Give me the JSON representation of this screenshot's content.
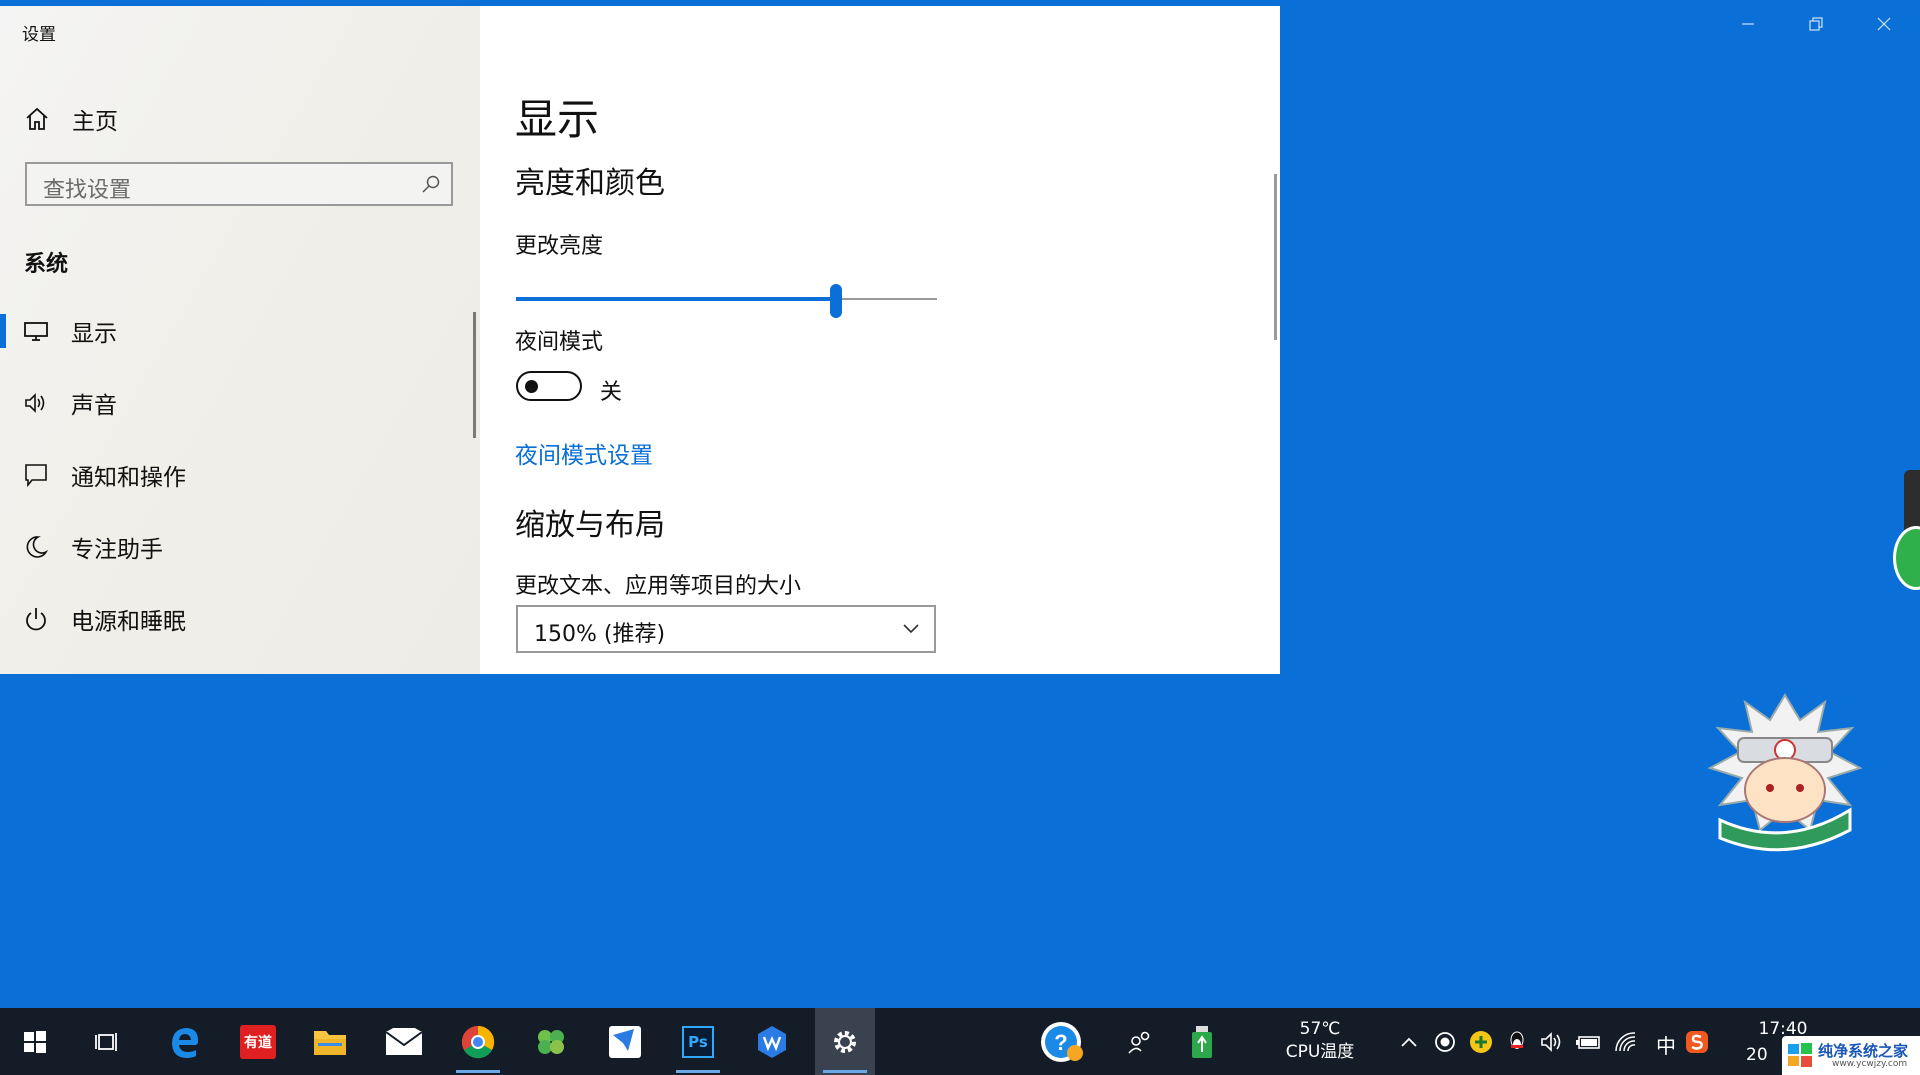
{
  "window": {
    "app_title": "设置"
  },
  "sidebar": {
    "home_label": "主页",
    "search_placeholder": "查找设置",
    "section_title": "系统",
    "items": [
      {
        "label": "显示",
        "icon": "monitor-icon",
        "active": true
      },
      {
        "label": "声音",
        "icon": "speaker-icon"
      },
      {
        "label": "通知和操作",
        "icon": "notification-icon"
      },
      {
        "label": "专注助手",
        "icon": "moon-icon"
      },
      {
        "label": "电源和睡眠",
        "icon": "power-icon"
      }
    ]
  },
  "content": {
    "page_title": "显示",
    "brightness_section": "亮度和颜色",
    "brightness_label": "更改亮度",
    "brightness_value_fraction": 0.76,
    "night_mode_label": "夜间模式",
    "night_mode_state": "关",
    "night_mode_link": "夜间模式设置",
    "scale_section": "缩放与布局",
    "scale_label": "更改文本、应用等项目的大小",
    "scale_value": "150% (推荐)"
  },
  "taskbar": {
    "apps": [
      "start-icon",
      "task-view-icon",
      "edge-icon",
      "youdao-icon",
      "file-explorer-icon",
      "mail-icon",
      "chrome-icon",
      "clover-icon",
      "feishu-icon",
      "photoshop-icon",
      "wps-icon",
      "settings-icon"
    ],
    "youdao_text": "有道",
    "ps_text": "Ps",
    "cpu_temp": "57℃",
    "cpu_label": "CPU温度",
    "ime": "中",
    "time": "17:40",
    "date_partial": "20"
  },
  "watermark": {
    "text": "纯净系统之家",
    "url": "www.ycwjzy.com"
  },
  "colors": {
    "accent": "#0a6fd6",
    "desktop": "#0a6fd6",
    "taskbar": "#141c28"
  }
}
